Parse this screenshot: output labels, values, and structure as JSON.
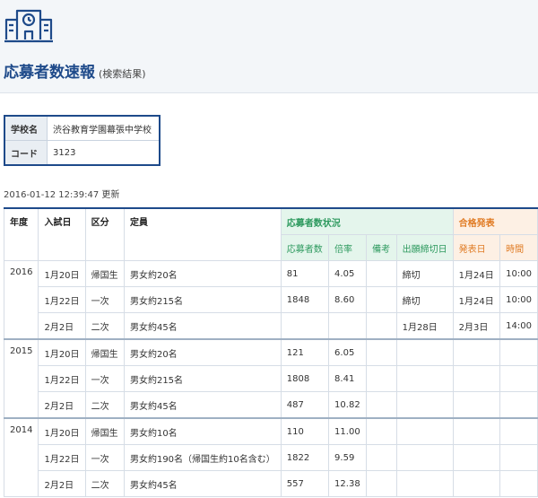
{
  "header": {
    "icon": "school-building-icon",
    "title": "応募者数速報",
    "subtitle": "(検索結果)"
  },
  "school": {
    "name_label": "学校名",
    "name": "渋谷教育学園幕張中学校",
    "code_label": "コード",
    "code": "3123"
  },
  "updated": "2016-01-12 12:39:47 更新",
  "table": {
    "headers": {
      "year": "年度",
      "exam_date": "入試日",
      "category": "区分",
      "capacity": "定員",
      "applicant_status": "応募者数状況",
      "applicants": "応募者数",
      "ratio": "倍率",
      "notes": "備考",
      "deadline": "出願締切日",
      "result": "合格発表",
      "result_date": "発表日",
      "result_time": "時間"
    },
    "years": [
      {
        "year": "2016",
        "rows": [
          {
            "date": "1月20日",
            "category": "帰国生",
            "capacity": "男女約20名",
            "applicants": "81",
            "ratio": "4.05",
            "note": "",
            "deadline": "締切",
            "result_date": "1月24日",
            "result_time": "10:00"
          },
          {
            "date": "1月22日",
            "category": "一次",
            "capacity": "男女約215名",
            "applicants": "1848",
            "ratio": "8.60",
            "note": "",
            "deadline": "締切",
            "result_date": "1月24日",
            "result_time": "10:00"
          },
          {
            "date": "2月2日",
            "category": "二次",
            "capacity": "男女約45名",
            "applicants": "",
            "ratio": "",
            "note": "",
            "deadline": "1月28日",
            "result_date": "2月3日",
            "result_time": "14:00"
          }
        ]
      },
      {
        "year": "2015",
        "rows": [
          {
            "date": "1月20日",
            "category": "帰国生",
            "capacity": "男女約20名",
            "applicants": "121",
            "ratio": "6.05",
            "note": "",
            "deadline": "",
            "result_date": "",
            "result_time": ""
          },
          {
            "date": "1月22日",
            "category": "一次",
            "capacity": "男女約215名",
            "applicants": "1808",
            "ratio": "8.41",
            "note": "",
            "deadline": "",
            "result_date": "",
            "result_time": ""
          },
          {
            "date": "2月2日",
            "category": "二次",
            "capacity": "男女約45名",
            "applicants": "487",
            "ratio": "10.82",
            "note": "",
            "deadline": "",
            "result_date": "",
            "result_time": ""
          }
        ]
      },
      {
        "year": "2014",
        "rows": [
          {
            "date": "1月20日",
            "category": "帰国生",
            "capacity": "男女約10名",
            "applicants": "110",
            "ratio": "11.00",
            "note": "",
            "deadline": "",
            "result_date": "",
            "result_time": ""
          },
          {
            "date": "1月22日",
            "category": "一次",
            "capacity": "男女約190名（帰国生約10名含む）",
            "applicants": "1822",
            "ratio": "9.59",
            "note": "",
            "deadline": "",
            "result_date": "",
            "result_time": ""
          },
          {
            "date": "2月2日",
            "category": "二次",
            "capacity": "男女約45名",
            "applicants": "557",
            "ratio": "12.38",
            "note": "",
            "deadline": "",
            "result_date": "",
            "result_time": ""
          }
        ]
      }
    ]
  },
  "colors": {
    "brand": "#1e4a8a",
    "applicant_header_bg": "#e4f5ec",
    "applicant_header_text": "#2e9a5f",
    "result_header_bg": "#fdf0e4",
    "result_header_text": "#e07b24"
  }
}
